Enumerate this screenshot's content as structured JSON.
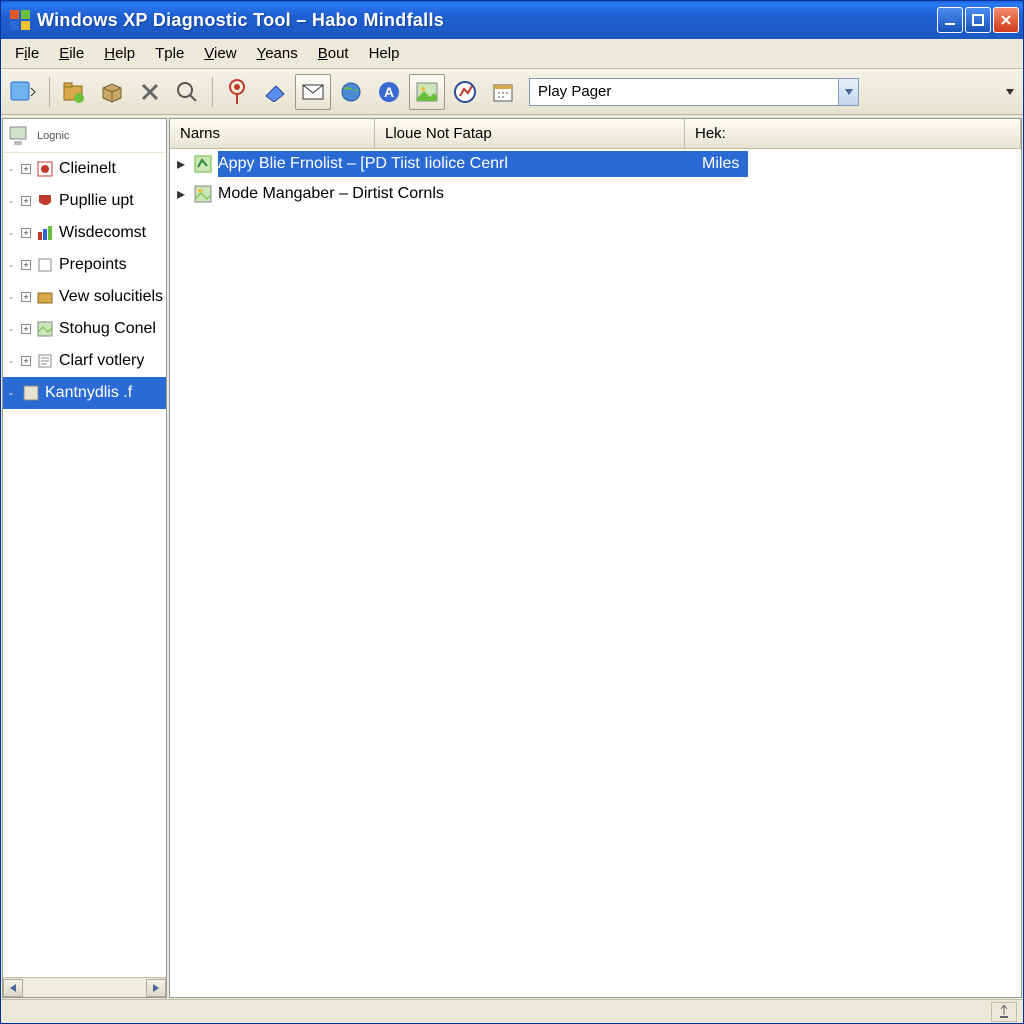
{
  "window": {
    "title": "Windows  XP Diagnostic Tool – Habo Mindfalls"
  },
  "menubar": {
    "items": [
      {
        "label": "File",
        "underline": 0
      },
      {
        "label": "Eile",
        "underline": 0
      },
      {
        "label": "Help",
        "underline": 0
      },
      {
        "label": "Tple",
        "underline": -1
      },
      {
        "label": "View",
        "underline": 0
      },
      {
        "label": "Yeans",
        "underline": 0
      },
      {
        "label": "Bout",
        "underline": 0
      },
      {
        "label": "Help",
        "underline": -1
      }
    ]
  },
  "toolbar": {
    "select_value": "Play Pager"
  },
  "sidebar": {
    "top_label": "Lognic",
    "items": [
      {
        "label": "Clieinelt",
        "selected": false
      },
      {
        "label": "Pupllie upt",
        "selected": false
      },
      {
        "label": "Wisdecomst",
        "selected": false
      },
      {
        "label": "Prepoints",
        "selected": false
      },
      {
        "label": "Vew solucitiels",
        "selected": false
      },
      {
        "label": "Stohug Conel",
        "selected": false
      },
      {
        "label": "Clarf votlery",
        "selected": false
      },
      {
        "label": "Kantnydlis .f",
        "selected": true
      }
    ]
  },
  "columns": {
    "c1": "Narns",
    "c2": "Lloue Not Fatap",
    "c3": "Hek:"
  },
  "rows": [
    {
      "name": "Appy Blie Frnolist – [PD Tiist Iiolice Cenrl",
      "hex": "Miles",
      "selected": true
    },
    {
      "name": "Mode Mangaber –  Dirtist Cornls",
      "hex": "",
      "selected": false
    }
  ]
}
